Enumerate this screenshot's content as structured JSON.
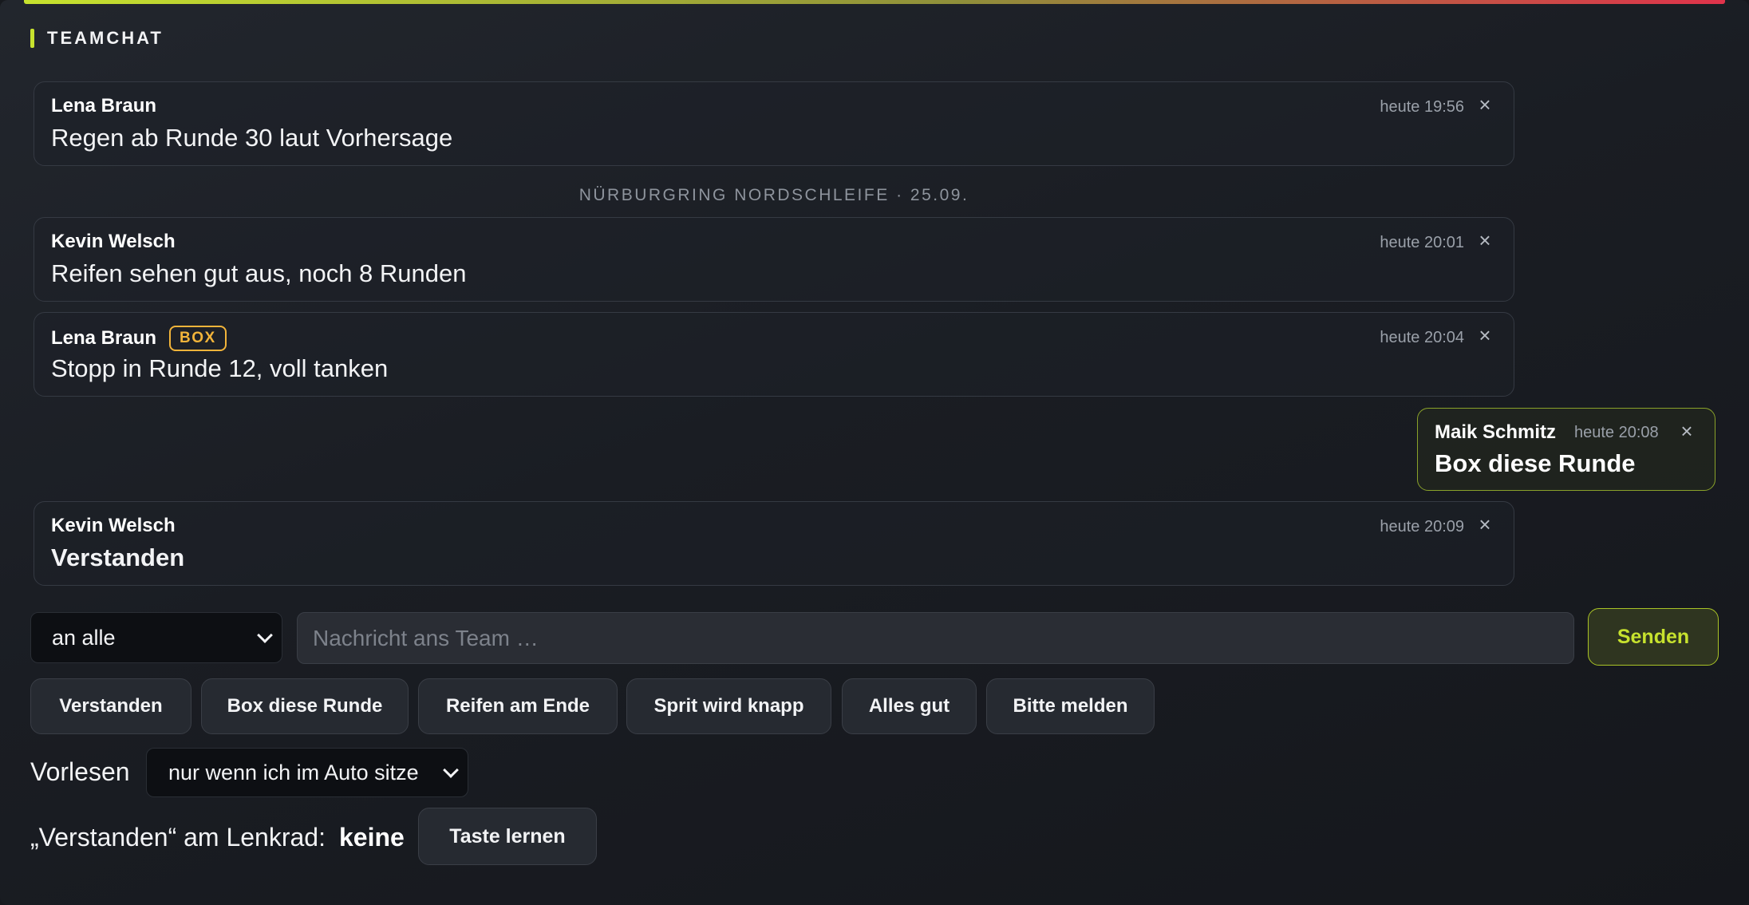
{
  "header": {
    "title": "TEAMCHAT"
  },
  "messages": [
    {
      "author": "Lena Braun",
      "badge": "",
      "time": "heute 19:56",
      "text": "Regen ab Runde 30 laut Vorhersage",
      "close": "×"
    },
    {
      "author": "Kevin Welsch",
      "badge": "",
      "time": "heute 20:01",
      "text": "Reifen sehen gut aus, noch 8 Runden",
      "close": "×"
    },
    {
      "author": "Lena Braun",
      "badge": "BOX",
      "time": "heute 20:04",
      "text": "Stopp in Runde 12, voll tanken",
      "close": "×"
    },
    {
      "author": "Kevin Welsch",
      "badge": "",
      "time": "heute 20:09",
      "text": "Verstanden",
      "close": "×"
    }
  ],
  "divider": "NÜRBURGRING NORDSCHLEIFE · 25.09.",
  "own_message": {
    "author": "Maik Schmitz",
    "time": "heute 20:08",
    "text": "Box diese Runde",
    "close": "×"
  },
  "composer": {
    "recipient": "an alle",
    "placeholder": "Nachricht ans Team …",
    "send_label": "Senden"
  },
  "quick_replies": [
    "Verstanden",
    "Box diese Runde",
    "Reifen am Ende",
    "Sprit wird knapp",
    "Alles gut",
    "Bitte melden"
  ],
  "tts": {
    "label": "Vorlesen",
    "value": "nur wenn ich im Auto sitze"
  },
  "wheel": {
    "label": "„Verstanden“ am Lenkrad:",
    "value": "keine",
    "button": "Taste lernen"
  },
  "colors": {
    "accent": "#c7e22e",
    "box_badge": "#f2b43a",
    "alert": "#e0334b"
  }
}
